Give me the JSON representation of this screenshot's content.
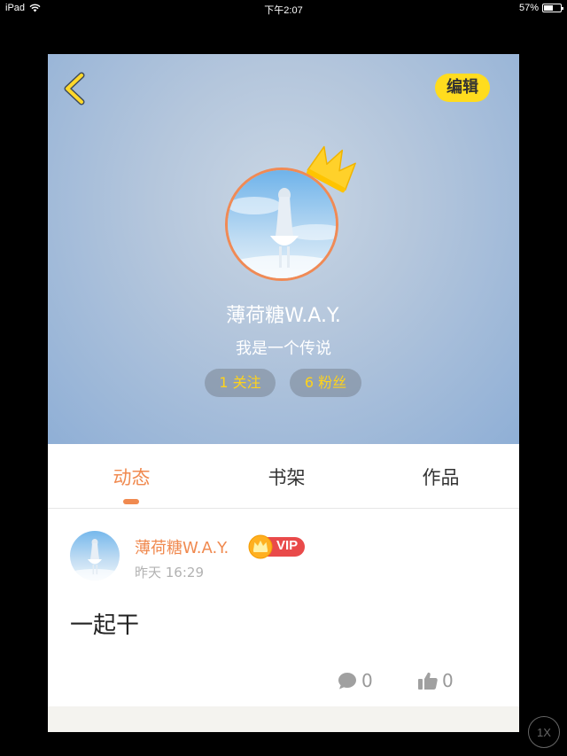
{
  "status_bar": {
    "device": "iPad",
    "time": "下午2:07",
    "battery": "57%",
    "battery_level": 0.57
  },
  "profile": {
    "edit_label": "编辑",
    "username": "薄荷糖W.A.Y.",
    "bio": "我是一个传说",
    "follow_label": "1 关注",
    "fans_label": "6 粉丝"
  },
  "tabs": [
    {
      "label": "动态",
      "active": true
    },
    {
      "label": "书架",
      "active": false
    },
    {
      "label": "作品",
      "active": false
    }
  ],
  "post": {
    "author": "薄荷糖W.A.Y.",
    "badge": "VIP",
    "time": "昨天 16:29",
    "text": "一起干",
    "comments": "0",
    "likes": "0"
  },
  "zoom_label": "1X",
  "colors": {
    "accent": "#f08a50",
    "edit_button": "#ffdc1e",
    "pill_text": "#ffd31a",
    "vip_red": "#e94a4a"
  },
  "icons": [
    "wifi-icon",
    "back-chevron-icon",
    "crown-icon",
    "vip-crown-icon",
    "comment-icon",
    "thumbs-up-icon"
  ]
}
